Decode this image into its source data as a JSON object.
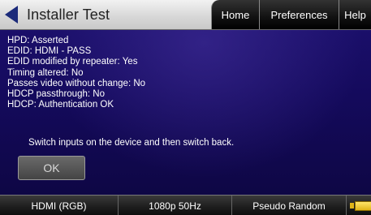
{
  "header": {
    "title": "Installer Test",
    "tabs": [
      {
        "label": "Home"
      },
      {
        "label": "Preferences"
      },
      {
        "label": "Help"
      }
    ]
  },
  "status_lines": [
    "HPD: Asserted",
    "EDID: HDMI - PASS",
    "EDID modified by repeater: Yes",
    "Timing altered: No",
    "Passes video without change: No",
    "HDCP passthrough: No",
    "HDCP: Authentication OK"
  ],
  "instruction": "Switch inputs on the device and then switch back.",
  "ok_label": "OK",
  "footer": {
    "interface": "HDMI (RGB)",
    "format": "1080p 50Hz",
    "pattern": "Pseudo Random",
    "battery_icon": "battery-icon"
  },
  "colors": {
    "background": "#140a5c",
    "back_arrow": "#1b2a7a",
    "battery": "#e0b418"
  }
}
